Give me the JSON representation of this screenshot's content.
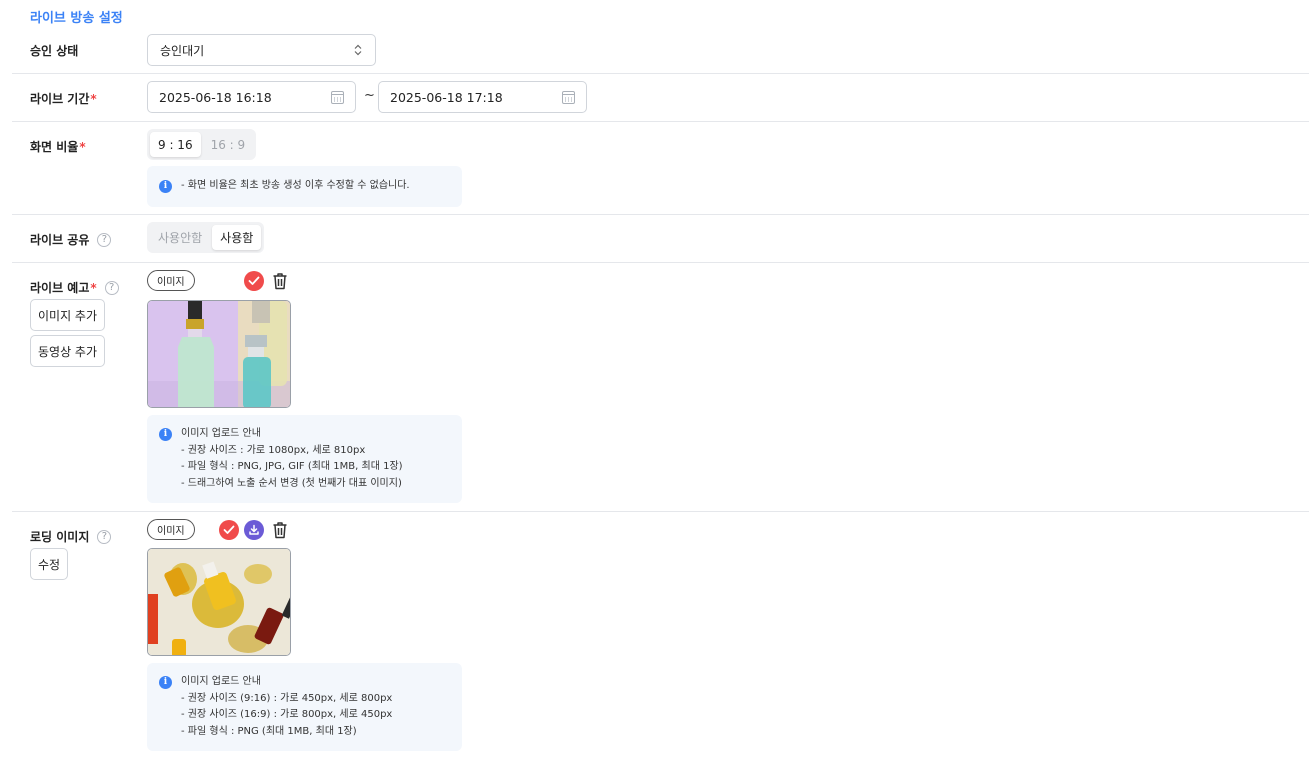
{
  "section_title": "라이브 방송 설정",
  "approval": {
    "label": "승인 상태",
    "value": "승인대기"
  },
  "period": {
    "label": "라이브 기간",
    "required_mark": "*",
    "start": "2025-06-18 16:18",
    "separator": "~",
    "end": "2025-06-18 17:18"
  },
  "ratio": {
    "label": "화면 비율",
    "required_mark": "*",
    "options": [
      "9 : 16",
      "16 : 9"
    ],
    "selected": "9 : 16",
    "info": "- 화면 비율은 최초 방송 생성 이후 수정할 수 없습니다."
  },
  "share": {
    "label": "라이브 공유",
    "help": "?",
    "options": [
      "사용안함",
      "사용함"
    ],
    "selected": "사용함"
  },
  "preview": {
    "label": "라이브 예고",
    "required_mark": "*",
    "help": "?",
    "add_image_label": "이미지 추가",
    "add_video_label": "동영상 추가",
    "media_tag": "이미지",
    "info_lines": [
      "이미지 업로드 안내",
      "- 권장 사이즈 : 가로 1080px, 세로 810px",
      "- 파일 형식 : PNG, JPG, GIF (최대 1MB, 최대 1장)",
      "- 드래그하여 노출 순서 변경 (첫 번째가 대표 이미지)"
    ]
  },
  "loading": {
    "label": "로딩 이미지",
    "help": "?",
    "edit_label": "수정",
    "media_tag": "이미지",
    "info_lines": [
      "이미지 업로드 안내",
      "- 권장 사이즈 (9:16) : 가로 450px, 세로 800px",
      "- 권장 사이즈 (16:9) : 가로 800px, 세로 450px",
      "- 파일 형식 : PNG (최대 1MB, 최대 1장)"
    ]
  },
  "colors": {
    "accent": "#3b82f6",
    "required": "#ef4444",
    "check": "#f04b4b",
    "download": "#6b5bd6",
    "info_bg": "#f3f7fc"
  },
  "icons": [
    "select-updown-icon",
    "calendar-icon",
    "help-icon",
    "info-icon",
    "check-icon",
    "download-icon",
    "trash-icon"
  ]
}
